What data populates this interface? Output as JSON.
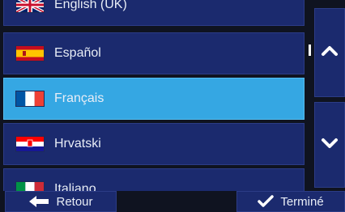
{
  "languages": [
    {
      "label": "English (UK)",
      "flag": "uk",
      "selected": false
    },
    {
      "label": "Español",
      "flag": "es",
      "selected": false
    },
    {
      "label": "Français",
      "flag": "fr",
      "selected": true
    },
    {
      "label": "Hrvatski",
      "flag": "hr",
      "selected": false
    },
    {
      "label": "Italiano",
      "flag": "it",
      "selected": false
    }
  ],
  "footer": {
    "back_label": "Retour",
    "done_label": "Terminé"
  },
  "icons": {
    "back": "arrow-left-icon",
    "done": "checkmark-icon",
    "up": "chevron-up-icon",
    "down": "chevron-down-icon"
  },
  "colors": {
    "row": "#1b2a6e",
    "selected": "#35a7e3",
    "text": "#e8edf6"
  }
}
